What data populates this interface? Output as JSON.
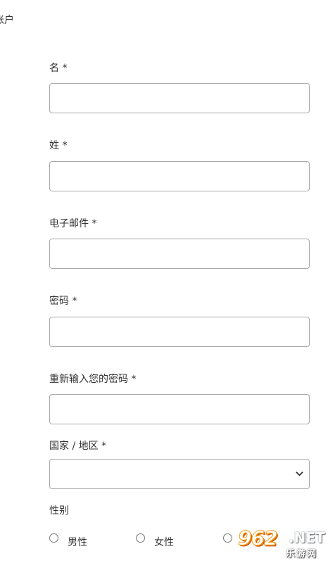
{
  "page": {
    "heading": "账户"
  },
  "form": {
    "first_name_label": "名 *",
    "first_name_value": "",
    "last_name_label": "姓 *",
    "last_name_value": "",
    "email_label": "电子邮件 *",
    "email_value": "",
    "password_label": "密码 *",
    "password_value": "",
    "confirm_password_label": "重新输入您的密码 *",
    "confirm_password_value": "",
    "country_label": "国家 / 地区 *",
    "country_selected": "",
    "gender_label": "性别",
    "gender_options": [
      "男性",
      "女性",
      ""
    ]
  },
  "watermark": {
    "number": "962",
    "suffix": ".NET",
    "site_name": "乐游网"
  },
  "colors": {
    "border": "#a9a9a9",
    "text": "#333333",
    "watermark_orange": "#f39c12"
  },
  "icons": {
    "select_arrow": "chevron-down-icon",
    "radio": "radio-button-icon"
  }
}
